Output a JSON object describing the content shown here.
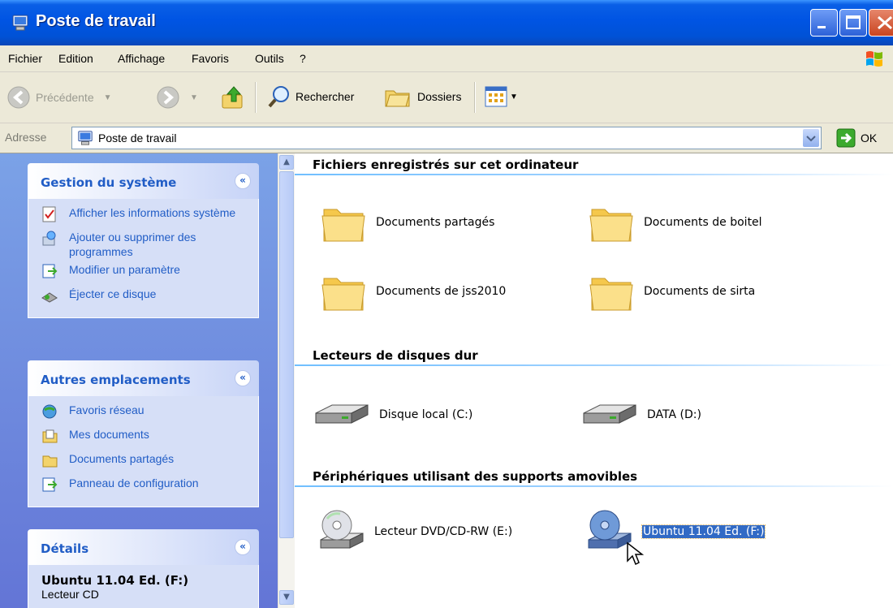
{
  "window": {
    "title": "Poste de travail"
  },
  "menu": [
    "Fichier",
    "Edition",
    "Affichage",
    "Favoris",
    "Outils",
    "?"
  ],
  "toolbar": {
    "back_label": "Précédente",
    "search_label": "Rechercher",
    "folders_label": "Dossiers"
  },
  "address": {
    "label": "Adresse",
    "value": "Poste de travail",
    "go_label": "OK"
  },
  "system_tasks": {
    "title": "Gestion du système",
    "items": [
      "Afficher les informations système",
      "Ajouter ou supprimer des programmes",
      "Modifier un paramètre",
      "Éjecter ce disque"
    ]
  },
  "other_places": {
    "title": "Autres emplacements",
    "items": [
      "Favoris réseau",
      "Mes documents",
      "Documents partagés",
      "Panneau de configuration"
    ]
  },
  "details": {
    "title": "Détails",
    "name": "Ubuntu 11.04 Ed. (F:)",
    "type": "Lecteur CD"
  },
  "groups": {
    "files": {
      "title": "Fichiers enregistrés sur cet ordinateur",
      "items": [
        "Documents partagés",
        "Documents de boitel",
        "Documents de jss2010",
        "Documents de sirta"
      ]
    },
    "hard_drives": {
      "title": "Lecteurs de disques dur",
      "items": [
        "Disque local (C:)",
        "DATA (D:)"
      ]
    },
    "removable": {
      "title": "Périphériques utilisant des supports amovibles",
      "items": [
        "Lecteur DVD/CD-RW (E:)",
        "Ubuntu 11.04 Ed. (F:)"
      ]
    }
  },
  "colors": {
    "title_bar": "#0054e3",
    "task_pane": "#7ba2e7",
    "task_link": "#215dc6",
    "selection": "#316ac5"
  },
  "selected_item": "Ubuntu 11.04 Ed. (F:)"
}
